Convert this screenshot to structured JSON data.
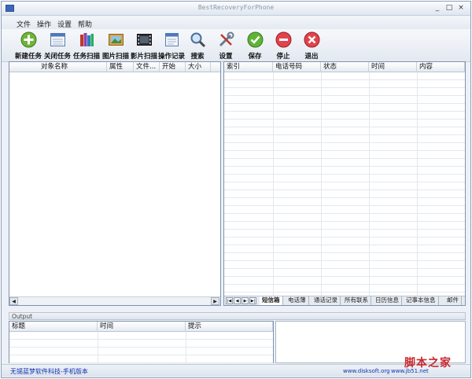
{
  "window": {
    "title": "BestRecoveryForPhone",
    "minimize": "_",
    "maximize": "□",
    "close": "×"
  },
  "menu": [
    "文件",
    "操作",
    "设置",
    "帮助"
  ],
  "toolbar": [
    {
      "label": "新建任务",
      "icon": "new-task-icon"
    },
    {
      "label": "关闭任务",
      "icon": "close-task-icon"
    },
    {
      "label": "任务扫描",
      "icon": "task-scan-icon"
    },
    {
      "label": "图片扫描",
      "icon": "image-scan-icon"
    },
    {
      "label": "影片扫描",
      "icon": "video-scan-icon"
    },
    {
      "label": "操作记录",
      "icon": "operation-log-icon"
    },
    {
      "label": "搜索",
      "icon": "search-icon"
    },
    {
      "label": "设置",
      "icon": "settings-icon"
    },
    {
      "label": "保存",
      "icon": "save-icon"
    },
    {
      "label": "停止",
      "icon": "stop-icon"
    },
    {
      "label": "退出",
      "icon": "exit-icon"
    }
  ],
  "left_table": {
    "columns": [
      "对象名称",
      "属性",
      "文件...",
      "开始",
      "大小"
    ]
  },
  "right_table": {
    "columns": [
      "索引",
      "电话号码",
      "状态",
      "时间",
      "内容"
    ]
  },
  "tabs": [
    "短信箱",
    "电话薄",
    "通话记录",
    "所有联系",
    "日历信息",
    "记事本信息",
    "邮件"
  ],
  "output": {
    "title": "Output",
    "columns": [
      "标题",
      "时间",
      "提示"
    ]
  },
  "status": {
    "left": "无锡蓝梦软件科技-手机版本",
    "right": "www.disksoft.org",
    "right2": "www.jb51.net"
  },
  "watermark": "脚本之家",
  "colors": {
    "accent": "#3b68b8",
    "status_text": "#1030b0",
    "watermark": "#c8282e"
  }
}
